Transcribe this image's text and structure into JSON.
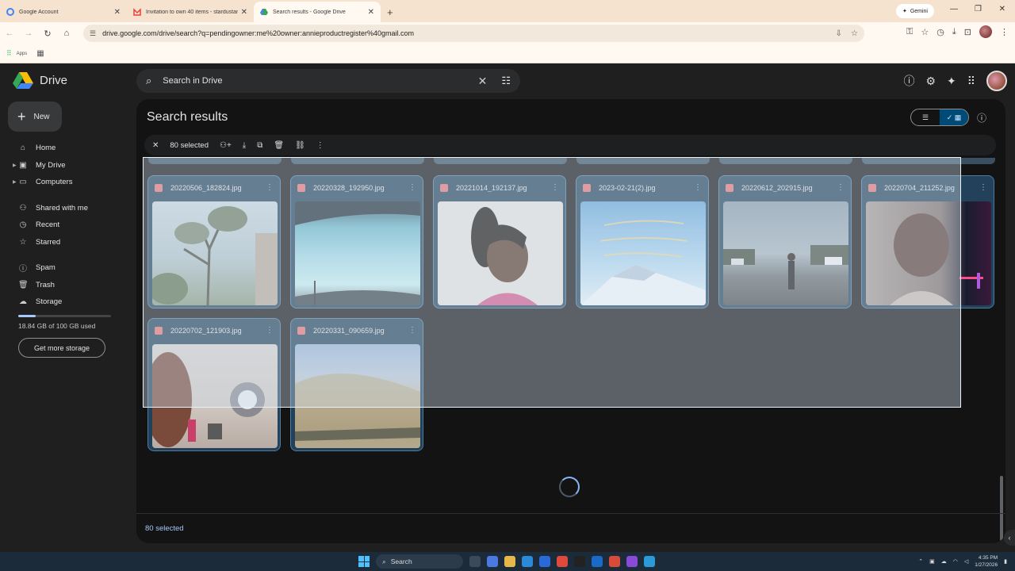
{
  "browser": {
    "tabs": [
      {
        "label": "Google Account",
        "favicon": "google-g-icon",
        "active": false
      },
      {
        "label": "Invitation to own 40 items - stardustand...",
        "favicon": "gmail-icon",
        "active": false
      },
      {
        "label": "Search results - Google Drive",
        "favicon": "drive-icon",
        "active": true
      }
    ],
    "gemini_label": "Gemini",
    "url": "drive.google.com/drive/search?q=pendingowner:me%20owner:annieproductregister%40gmail.com",
    "bookmarks": {
      "apps_label": "Apps"
    }
  },
  "drive": {
    "app_name": "Drive",
    "search": {
      "text": "Search in Drive"
    },
    "new_button": "New",
    "nav": [
      {
        "label": "Home",
        "icon": "home-icon",
        "caret": false
      },
      {
        "label": "My Drive",
        "icon": "my-drive-icon",
        "caret": true
      },
      {
        "label": "Computers",
        "icon": "computer-icon",
        "caret": true
      },
      {
        "label": "Shared with me",
        "icon": "shared-icon",
        "caret": false
      },
      {
        "label": "Recent",
        "icon": "clock-icon",
        "caret": false
      },
      {
        "label": "Starred",
        "icon": "star-icon",
        "caret": false
      },
      {
        "label": "Spam",
        "icon": "spam-icon",
        "caret": false
      },
      {
        "label": "Trash",
        "icon": "trash-icon",
        "caret": false
      },
      {
        "label": "Storage",
        "icon": "cloud-icon",
        "caret": false
      }
    ],
    "storage": {
      "text": "18.84 GB of 100 GB used",
      "used_fraction": 0.1884,
      "get_more": "Get more storage"
    },
    "page_title": "Search results",
    "selection": {
      "count_label": "80 selected"
    },
    "files": [
      {
        "name": "20220506_182824.jpg",
        "thumb": "trees-sky"
      },
      {
        "name": "20220328_192950.jpg",
        "thumb": "car-window-sky"
      },
      {
        "name": "20221014_192137.jpg",
        "thumb": "portrait-woman"
      },
      {
        "name": "2023-02-21(2).jpg",
        "thumb": "mountain-text"
      },
      {
        "name": "20220612_202915.jpg",
        "thumb": "parking-lot"
      },
      {
        "name": "20220704_211252.jpg",
        "thumb": "selfie-night"
      },
      {
        "name": "20220702_121903.jpg",
        "thumb": "interior-balloons"
      },
      {
        "name": "20220331_090659.jpg",
        "thumb": "hillside"
      }
    ],
    "footer_label": "80 selected"
  },
  "taskbar": {
    "search_label": "Search",
    "time": "4:35 PM",
    "date": "1/27/2026"
  },
  "colors": {
    "selected_card": "#23415a",
    "accent": "#a8c7fa",
    "overlay": "rgba(210,225,240,0.38)"
  }
}
